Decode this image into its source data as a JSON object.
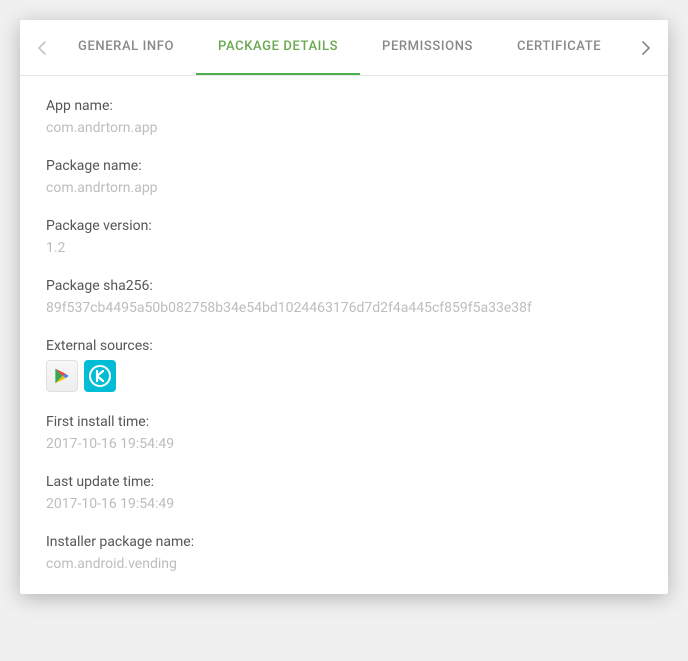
{
  "tabs": {
    "general_info": "GENERAL INFO",
    "package_details": "PACKAGE DETAILS",
    "permissions": "PERMISSIONS",
    "certificate": "CERTIFICATE"
  },
  "fields": {
    "app_name": {
      "label": "App name:",
      "value": "com.andrtorn.app"
    },
    "package_name": {
      "label": "Package name:",
      "value": "com.andrtorn.app"
    },
    "package_version": {
      "label": "Package version:",
      "value": "1.2"
    },
    "package_sha256": {
      "label": "Package sha256:",
      "value": "89f537cb4495a50b082758b34e54bd1024463176d7d2f4a445cf859f5a33e38f"
    },
    "external_sources": {
      "label": "External sources:"
    },
    "first_install_time": {
      "label": "First install time:",
      "value": "2017-10-16 19:54:49"
    },
    "last_update_time": {
      "label": "Last update time:",
      "value": "2017-10-16 19:54:49"
    },
    "installer_package_name": {
      "label": "Installer package name:",
      "value": "com.android.vending"
    }
  }
}
